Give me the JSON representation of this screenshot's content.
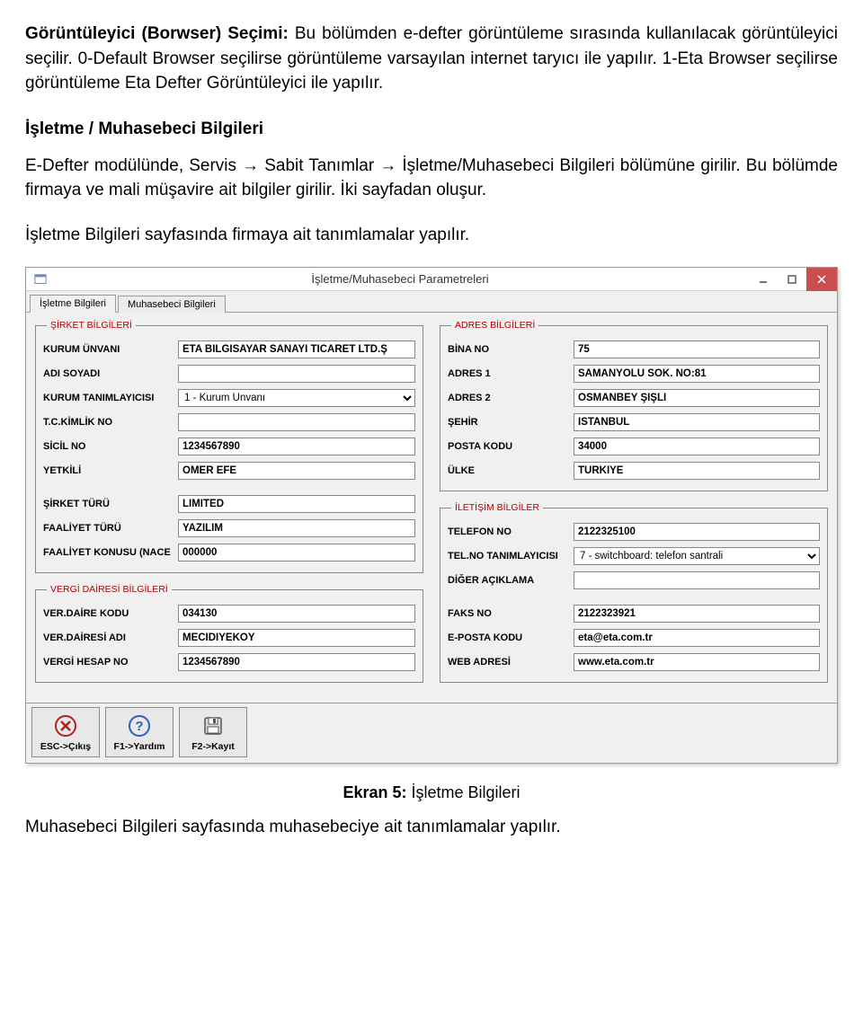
{
  "doc": {
    "p1_label": "Görüntüleyici (Borwser) Seçimi:",
    "p1_rest": " Bu bölümden e-defter görüntüleme sırasında kullanılacak görüntüleyici seçilir.  0-Default Browser seçilirse görüntüleme varsayılan internet taryıcı ile yapılır. 1-Eta Browser seçilirse görüntüleme Eta Defter Görüntüleyici ile yapılır.",
    "h1": "İşletme / Muhasebeci Bilgileri",
    "p2": "E-Defter modülünde, Servis → Sabit Tanımlar → İşletme/Muhasebeci Bilgileri bölümüne girilir. Bu bölümde firmaya ve mali müşavire ait bilgiler girilir. İki sayfadan oluşur.",
    "p3": "İşletme Bilgileri sayfasında firmaya ait tanımlamalar yapılır.",
    "caption_bold": "Ekran 5:",
    "caption_rest": " İşletme Bilgileri",
    "p4": "Muhasebeci Bilgileri sayfasında muhasebeciye ait tanımlamalar yapılır."
  },
  "window": {
    "title": "İşletme/Muhasebeci Parametreleri",
    "tabs": [
      "İşletme Bilgileri",
      "Muhasebeci Bilgileri"
    ],
    "groups": {
      "sirket": "ŞİRKET BİLGİLERİ",
      "adres": "ADRES BİLGİLERİ",
      "vergi": "VERGİ DAİRESİ BİLGİLERİ",
      "iletisim": "İLETİŞİM BİLGİLER"
    },
    "labels": {
      "kurum_unvani": "KURUM ÜNVANI",
      "adi_soyadi": "ADI SOYADI",
      "kurum_tanimlayici": "KURUM TANIMLAYICISI",
      "tc": "T.C.KİMLİK NO",
      "sicil": "SİCİL NO",
      "yetkili": "YETKİLİ",
      "sirket_turu": "ŞİRKET TÜRÜ",
      "faaliyet_turu": "FAALİYET TÜRÜ",
      "faaliyet_konusu": "FAALİYET KONUSU (NACE",
      "ver_daire_kodu": "VER.DAİRE KODU",
      "ver_dairesi_adi": "VER.DAİRESİ ADI",
      "vergi_hesap_no": "VERGİ HESAP NO",
      "bina_no": "BİNA NO",
      "adres1": "ADRES 1",
      "adres2": "ADRES 2",
      "sehir": "ŞEHİR",
      "posta_kodu": "POSTA KODU",
      "ulke": "ÜLKE",
      "telefon_no": "TELEFON NO",
      "tel_tanimlayici": "TEL.NO TANIMLAYICISI",
      "diger_aciklama": "DİĞER AÇIKLAMA",
      "faks_no": "FAKS NO",
      "eposta_kodu": "E-POSTA KODU",
      "web_adresi": "WEB ADRESİ"
    },
    "values": {
      "kurum_unvani": "ETA BİLGİSAYAR SANAYİ TİCARET LTD.Ş",
      "adi_soyadi": "",
      "kurum_tanimlayici": "1 - Kurum Unvanı",
      "tc": "",
      "sicil": "1234567890",
      "yetkili": "ÖMER EFE",
      "sirket_turu": "LİMİTED",
      "faaliyet_turu": "YAZILIM",
      "faaliyet_konusu": "000000",
      "ver_daire_kodu": "034130",
      "ver_dairesi_adi": "MECİDİYEKÖY",
      "vergi_hesap_no": "1234567890",
      "bina_no": "75",
      "adres1": "SAMANYOLU SOK. NO:81",
      "adres2": "OSMANBEY ŞİŞLİ",
      "sehir": "İSTANBUL",
      "posta_kodu": "34000",
      "ulke": "TÜRKİYE",
      "telefon_no": "2122325100",
      "tel_tanimlayici": "7 - switchboard: telefon santrali",
      "diger_aciklama": "",
      "faks_no": "2122323921",
      "eposta_kodu": "eta@eta.com.tr",
      "web_adresi": "www.eta.com.tr"
    },
    "actions": {
      "esc": "ESC->Çıkış",
      "f1": "F1->Yardım",
      "f2": "F2->Kayıt"
    }
  }
}
